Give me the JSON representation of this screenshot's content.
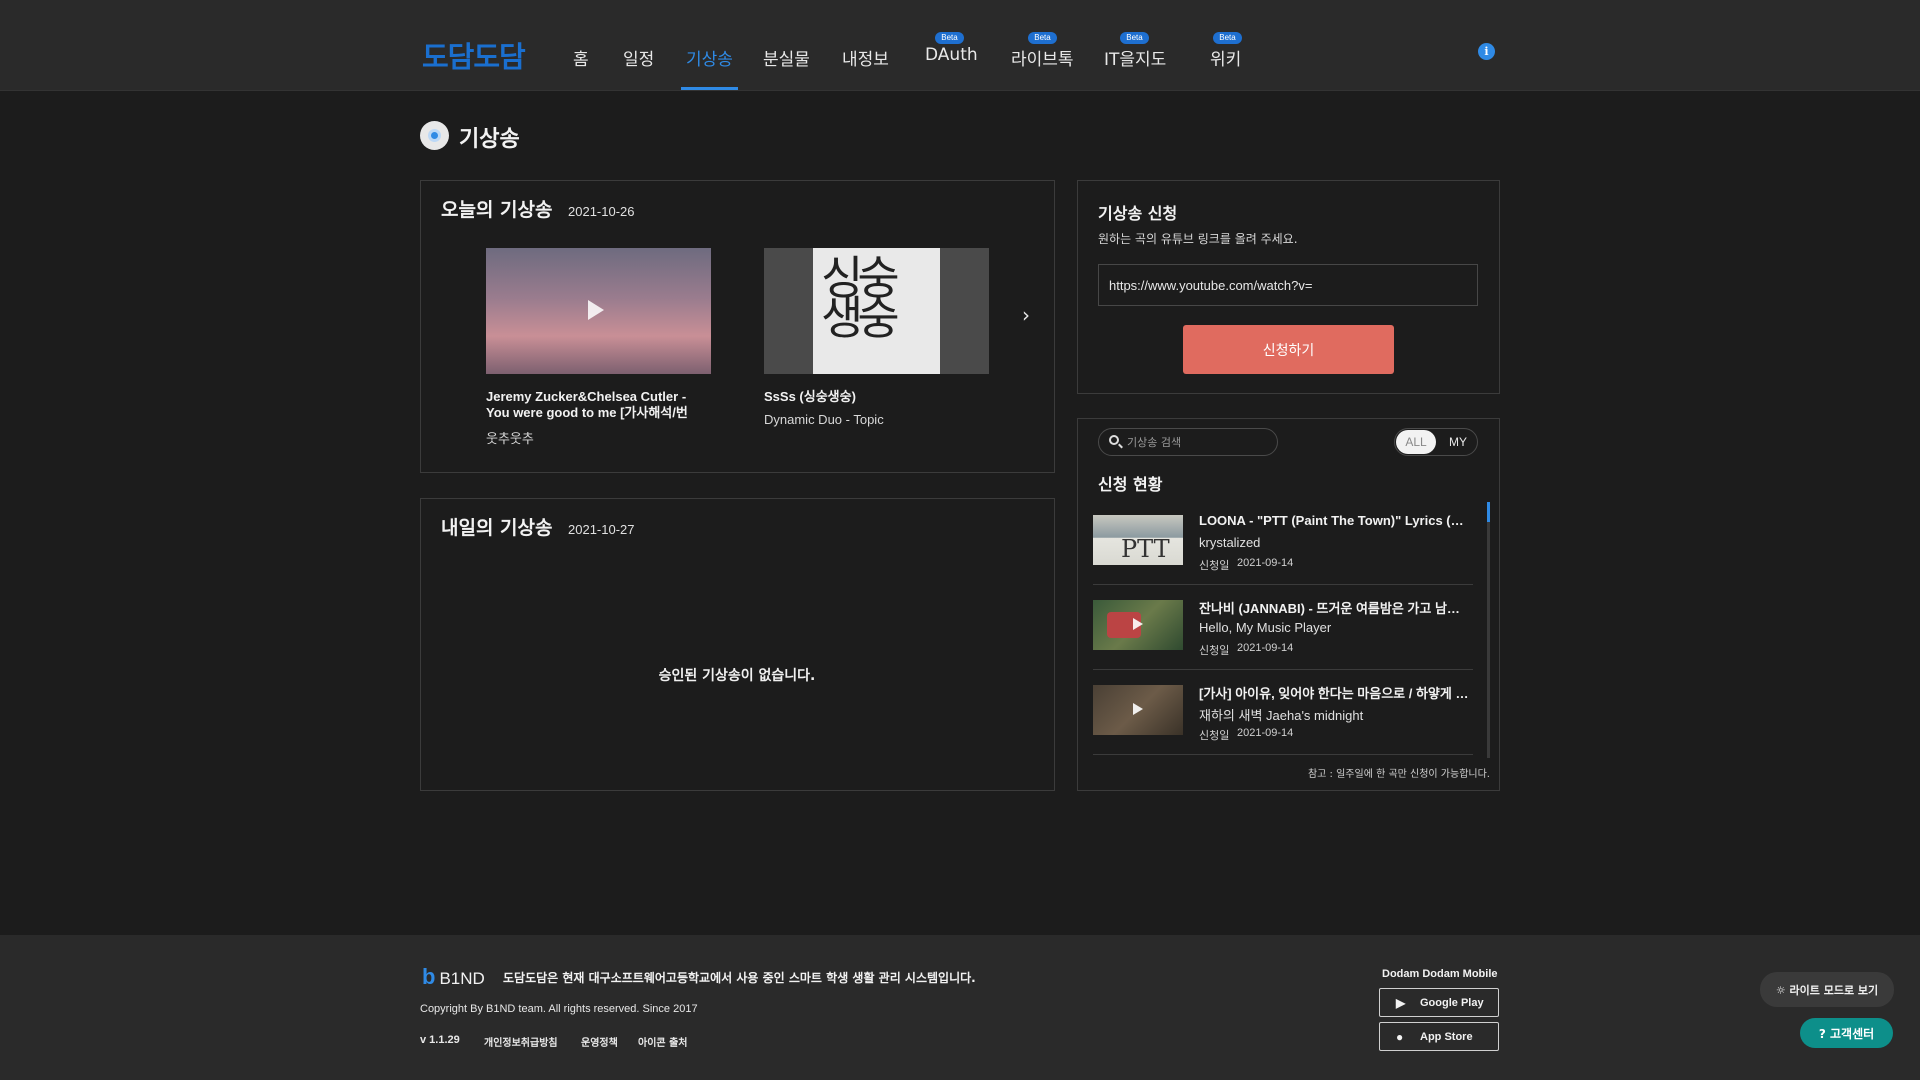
{
  "header": {
    "logo": "도담도담",
    "nav": [
      {
        "label": "홈"
      },
      {
        "label": "일정"
      },
      {
        "label": "기상송"
      },
      {
        "label": "분실물"
      },
      {
        "label": "내정보"
      },
      {
        "label": "DAuth",
        "badge": "Beta"
      },
      {
        "label": "라이브톡",
        "badge": "Beta"
      },
      {
        "label": "IT을지도",
        "badge": "Beta"
      },
      {
        "label": "위키",
        "badge": "Beta"
      }
    ],
    "active_nav": "기상송",
    "info_icon": "i"
  },
  "page": {
    "title": "기상송"
  },
  "today": {
    "heading": "오늘의 기상송",
    "date": "2021-10-26",
    "songs": [
      {
        "title": "Jeremy Zucker&Chelsea Cutler - You were good to me [가사해석/번역…",
        "channel": "웃추웃추"
      },
      {
        "title": "SsSs (싱숭생숭)",
        "channel": "Dynamic Duo - Topic"
      }
    ],
    "next_icon": "›"
  },
  "tomorrow": {
    "heading": "내일의 기상송",
    "date": "2021-10-27",
    "empty_message": "승인된 기상송이 없습니다."
  },
  "request": {
    "title": "기상송 신청",
    "description": "원하는 곡의 유튜브 링크를 올려 주세요.",
    "input_value": "https://www.youtube.com/watch?v=",
    "submit_label": "신청하기"
  },
  "status": {
    "search_placeholder": "기상송 검색",
    "filter_all": "ALL",
    "filter_my": "MY",
    "title": "신청 현황",
    "date_label": "신청일",
    "items": [
      {
        "title": "LOONA - \"PTT (Paint The Town)\" Lyrics (…",
        "channel": "krystalized",
        "date": "2021-09-14"
      },
      {
        "title": "잔나비 (JANNABI) - 뜨거운 여름밤은 가고 남은…",
        "channel": "Hello, My Music Player",
        "date": "2021-09-14"
      },
      {
        "title": "[가사] 아이유, 잊어야 한다는 마음으로 / 하얗게 …",
        "channel": "재하의 새벽 Jaeha's midnight",
        "date": "2021-09-14"
      }
    ],
    "note": "참고 : 일주일에 한 곡만 신청이 가능합니다."
  },
  "footer": {
    "brand": "B1ND",
    "description": "도담도담은 현재 대구소프트웨어고등학교에서 사용 중인 스마트 학생 생활 관리 시스템입니다.",
    "copyright": "Copyright By B1ND team. All rights reserved. Since 2017",
    "version": "v 1.1.29",
    "links": [
      "개인정보취급방침",
      "운영정책",
      "아이콘 출처"
    ],
    "mobile_title": "Dodam Dodam Mobile",
    "google_play": "Google Play",
    "app_store": "App Store",
    "light_mode": "라이트 모드로 보기",
    "help": "고객센터"
  }
}
